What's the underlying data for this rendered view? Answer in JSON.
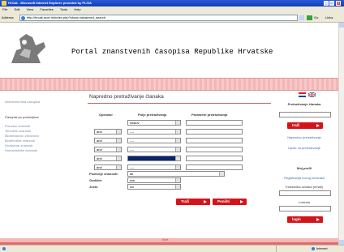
{
  "window": {
    "title": "HrCak - Microsoft Internet Explorer provided by PLIVA",
    "buttons": {
      "minimize": "_",
      "maximize": "□",
      "close": "×"
    }
  },
  "menu": [
    "File",
    "Edit",
    "View",
    "Favorites",
    "Tools",
    "Help"
  ],
  "address": {
    "label": "Address",
    "url": "http://hrcak.srce.hr/index.php?show=advanced_search",
    "go": "Go",
    "links": "Links"
  },
  "page": {
    "title": "Portal znanstvenih časopisa Republike Hrvatske",
    "sidebar": {
      "all_journals": "Abecedna lista časopisa",
      "by_field_heading": "Časopisi po područjima",
      "fields": [
        "Prirodne znanosti",
        "Tehničke znanosti",
        "Biomedicina i zdravstvo",
        "Biotehničke znanosti",
        "Društvene znanosti",
        "Humanističke znanosti"
      ]
    },
    "form": {
      "title": "Napredno pretraživanje članaka",
      "col_operator": "Operator",
      "col_field": "Polje pretraživanja",
      "col_params": "Parametri pretraživanja",
      "rows": [
        {
          "operator": "",
          "field": "naslov"
        },
        {
          "operator": "and",
          "field": "----"
        },
        {
          "operator": "and",
          "field": "----"
        },
        {
          "operator": "and",
          "field": "----"
        },
        {
          "operator": "and",
          "field": ""
        },
        {
          "operator": "and",
          "field": "----"
        }
      ],
      "area_label": "Područje znanosti:",
      "area_value": "all",
      "year_label": "Godište:",
      "year_value": "sve",
      "lang_label": "Jezik:",
      "lang_value": "svi",
      "search_button": "Traži",
      "reset_button": "Poništi"
    },
    "right": {
      "search_heading": "Pretraživanje članaka",
      "search_button": "traži",
      "advanced_link": "Napredno pretraživanje",
      "help_link": "Upute za pretraživanje",
      "profile_heading": "Moj profil",
      "register_link": "Registracija novog korisnika",
      "username_label": "Korisnička oznaka (email)",
      "password_label": "Lozinka",
      "login_button": "login"
    },
    "footer": "Srce"
  },
  "status": {
    "left": "",
    "zone": "Internet"
  },
  "colors": {
    "accent": "#d4141a",
    "band": "#f3b6b6",
    "link": "#3b6fb6"
  }
}
